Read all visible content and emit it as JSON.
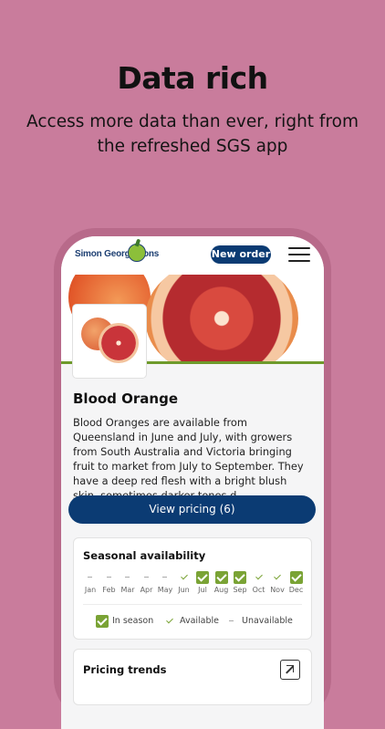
{
  "promo": {
    "headline": "Data rich",
    "subline": "Access more data than ever, right from the refreshed SGS app"
  },
  "app": {
    "brand": "Simon George Sons",
    "new_order_label": "New order"
  },
  "product": {
    "name": "Blood Orange",
    "description": "Blood Oranges are available from Queensland in June and July, with growers from South Australia and Victoria bringing fruit to market from July to September. They have a deep red flesh with a bright blush skin, sometimes darker tones d...",
    "pricing_button": "View pricing (6)"
  },
  "seasonal": {
    "title": "Seasonal availability",
    "months": [
      {
        "label": "Jan",
        "status": "unavailable"
      },
      {
        "label": "Feb",
        "status": "unavailable"
      },
      {
        "label": "Mar",
        "status": "unavailable"
      },
      {
        "label": "Apr",
        "status": "unavailable"
      },
      {
        "label": "May",
        "status": "unavailable"
      },
      {
        "label": "Jun",
        "status": "available"
      },
      {
        "label": "Jul",
        "status": "in-season"
      },
      {
        "label": "Aug",
        "status": "in-season"
      },
      {
        "label": "Sep",
        "status": "in-season"
      },
      {
        "label": "Oct",
        "status": "available"
      },
      {
        "label": "Nov",
        "status": "available"
      },
      {
        "label": "Dec",
        "status": "in-season"
      }
    ],
    "legend": {
      "in_season": "In season",
      "available": "Available",
      "unavailable": "Unavailable"
    }
  },
  "pricing_trends": {
    "title": "Pricing trends",
    "expand_icon": "expand-icon"
  },
  "colors": {
    "background": "#c97c9c",
    "primary": "#0b3b73",
    "accent_green": "#7aa335"
  }
}
